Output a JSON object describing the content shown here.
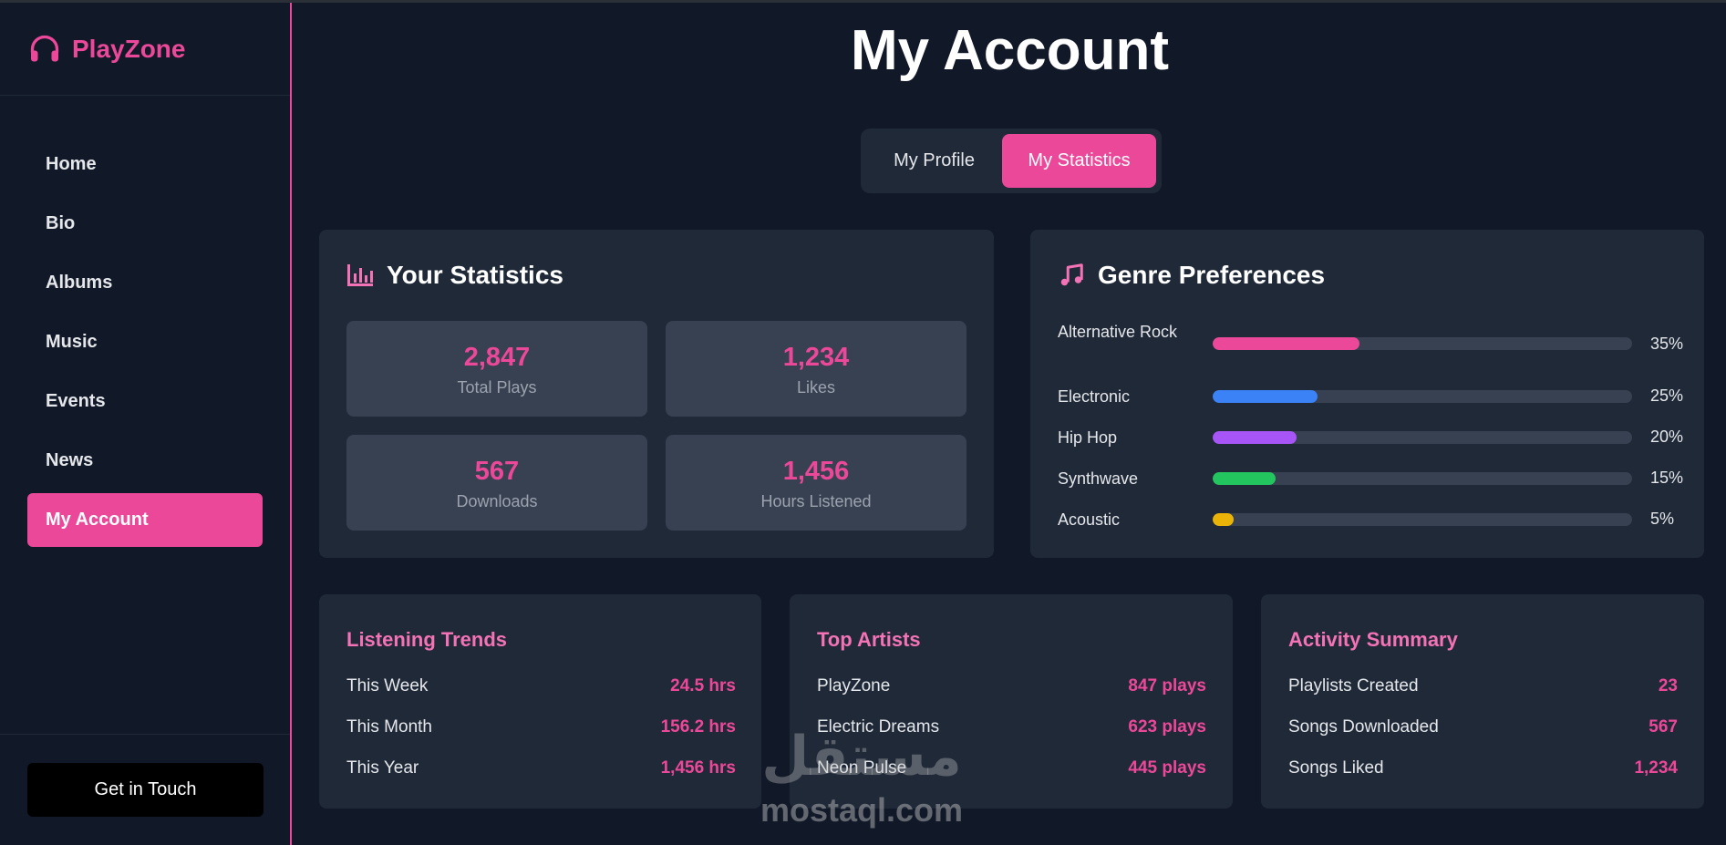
{
  "app": {
    "brand": "PlayZone",
    "brand_color": "#ec4899"
  },
  "sidebar": {
    "items": [
      {
        "label": "Home",
        "active": false
      },
      {
        "label": "Bio",
        "active": false
      },
      {
        "label": "Albums",
        "active": false
      },
      {
        "label": "Music",
        "active": false
      },
      {
        "label": "Events",
        "active": false
      },
      {
        "label": "News",
        "active": false
      },
      {
        "label": "My Account",
        "active": true
      }
    ],
    "footer_button": "Get in Touch"
  },
  "header": {
    "title": "My Account"
  },
  "tabs": [
    {
      "label": "My Profile",
      "active": false
    },
    {
      "label": "My Statistics",
      "active": true
    }
  ],
  "statistics": {
    "title": "Your Statistics",
    "icon": "bar-chart-icon",
    "items": [
      {
        "value": "2,847",
        "label": "Total Plays"
      },
      {
        "value": "1,234",
        "label": "Likes"
      },
      {
        "value": "567",
        "label": "Downloads"
      },
      {
        "value": "1,456",
        "label": "Hours Listened"
      }
    ]
  },
  "genres": {
    "title": "Genre Preferences",
    "icon": "music-note-icon",
    "items": [
      {
        "name": "Alternative Rock",
        "percent": 35,
        "pct_label": "35%",
        "color": "#ec4899"
      },
      {
        "name": "Electronic",
        "percent": 25,
        "pct_label": "25%",
        "color": "#3b82f6"
      },
      {
        "name": "Hip Hop",
        "percent": 20,
        "pct_label": "20%",
        "color": "#a855f7"
      },
      {
        "name": "Synthwave",
        "percent": 15,
        "pct_label": "15%",
        "color": "#22c55e"
      },
      {
        "name": "Acoustic",
        "percent": 5,
        "pct_label": "5%",
        "color": "#eab308"
      }
    ]
  },
  "listening_trends": {
    "title": "Listening Trends",
    "rows": [
      {
        "label": "This Week",
        "value": "24.5 hrs"
      },
      {
        "label": "This Month",
        "value": "156.2 hrs"
      },
      {
        "label": "This Year",
        "value": "1,456 hrs"
      }
    ]
  },
  "top_artists": {
    "title": "Top Artists",
    "rows": [
      {
        "label": "PlayZone",
        "value": "847 plays"
      },
      {
        "label": "Electric Dreams",
        "value": "623 plays"
      },
      {
        "label": "Neon Pulse",
        "value": "445 plays"
      }
    ]
  },
  "activity_summary": {
    "title": "Activity Summary",
    "rows": [
      {
        "label": "Playlists Created",
        "value": "23"
      },
      {
        "label": "Songs Downloaded",
        "value": "567"
      },
      {
        "label": "Songs Liked",
        "value": "1,234"
      }
    ]
  },
  "watermark": {
    "arabic": "مستقل",
    "latin": "mostaql.com"
  }
}
